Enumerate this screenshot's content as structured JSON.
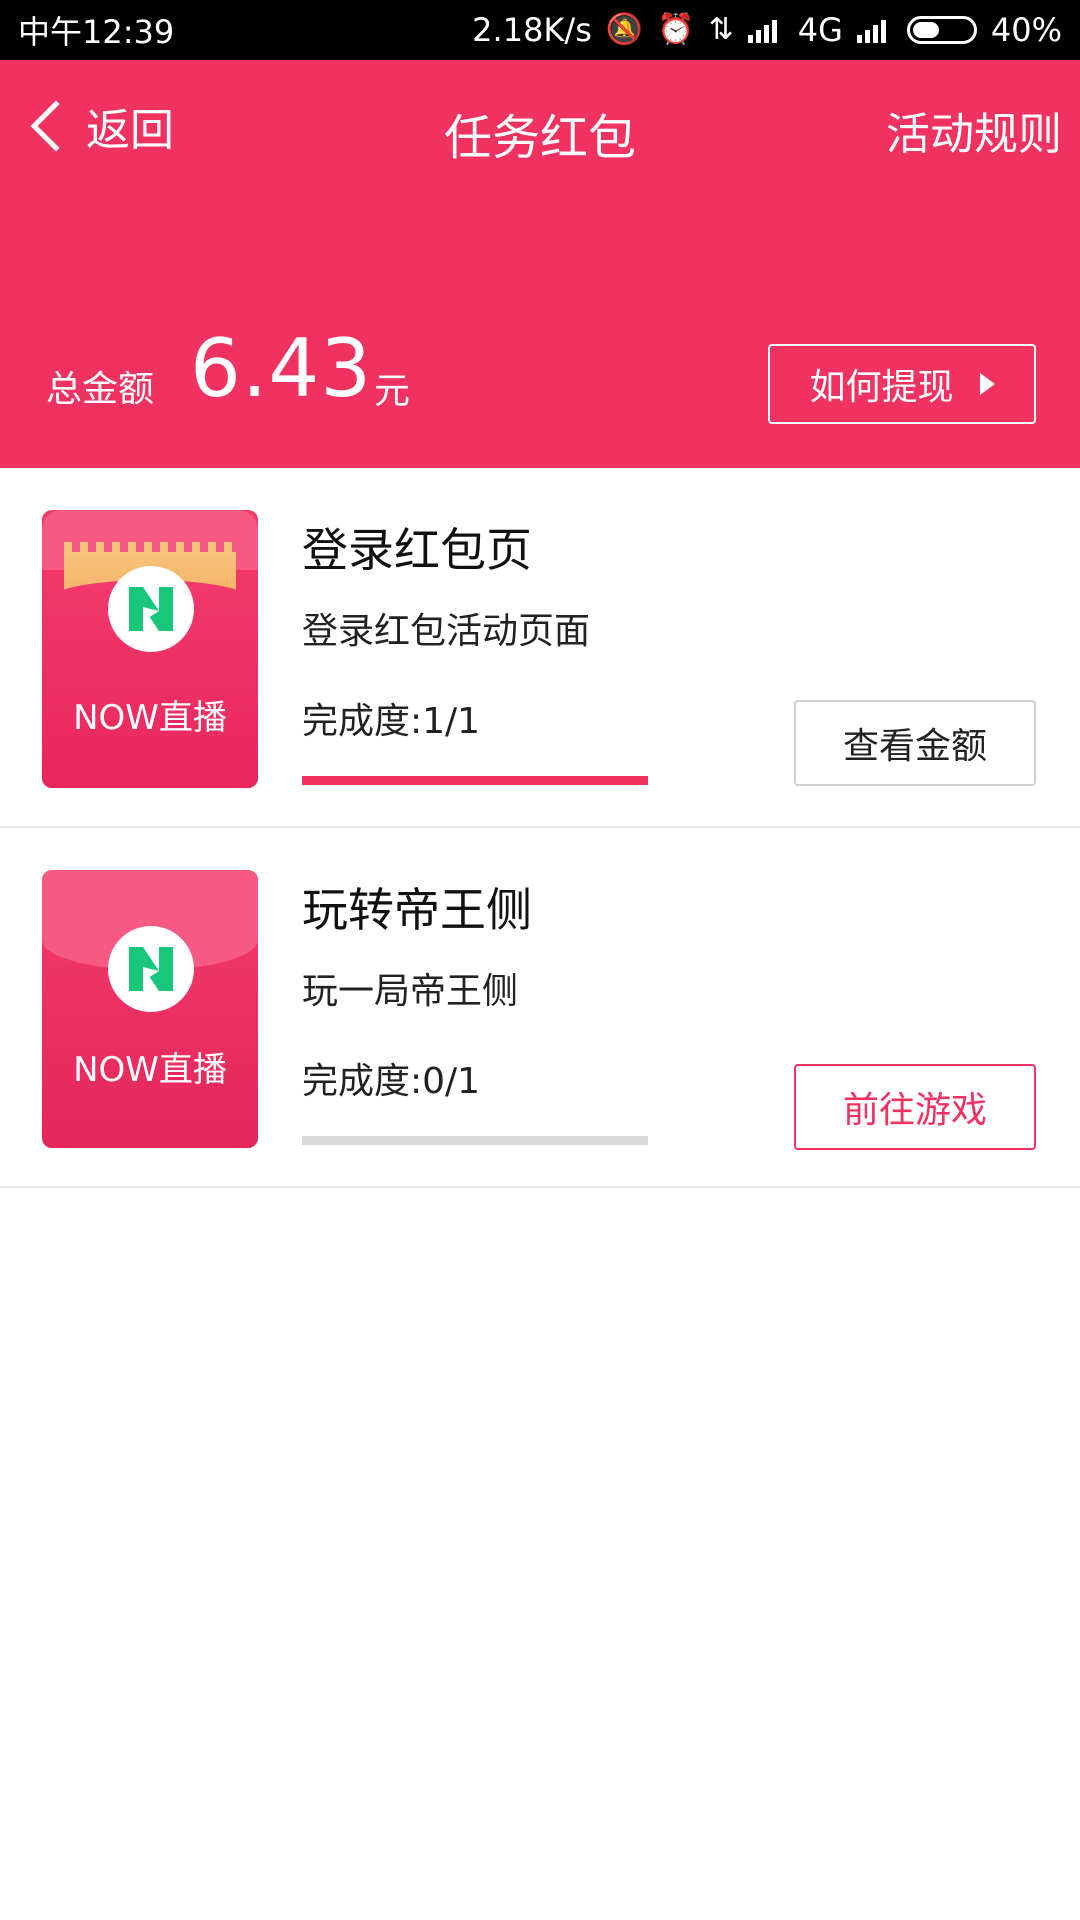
{
  "status_bar": {
    "time": "中午12:39",
    "speed": "2.18K/s",
    "network": "4G",
    "battery": "40%",
    "icons": [
      "bell-off-icon",
      "alarm-icon",
      "data-arrows-icon",
      "signal-icon",
      "signal-icon",
      "battery-icon"
    ]
  },
  "header": {
    "back_label": "返回",
    "title": "任务红包",
    "rules_label": "活动规则",
    "total_label": "总金额",
    "total_value": "6.43",
    "total_unit": "元",
    "withdraw_label": "如何提现"
  },
  "tasks": [
    {
      "title": "登录红包页",
      "description": "登录红包活动页面",
      "progress_text": "完成度:1/1",
      "progress_fraction": 1,
      "envelope_label": "NOW直播",
      "action_label": "查看金额"
    },
    {
      "title": "玩转帝王侧",
      "description": "玩一局帝王侧",
      "progress_text": "完成度:0/1",
      "progress_fraction": 0,
      "envelope_label": "NOW直播",
      "action_label": "前往游戏"
    }
  ],
  "colors": {
    "brand": "#f03261",
    "logo_green": "#17c77a"
  }
}
